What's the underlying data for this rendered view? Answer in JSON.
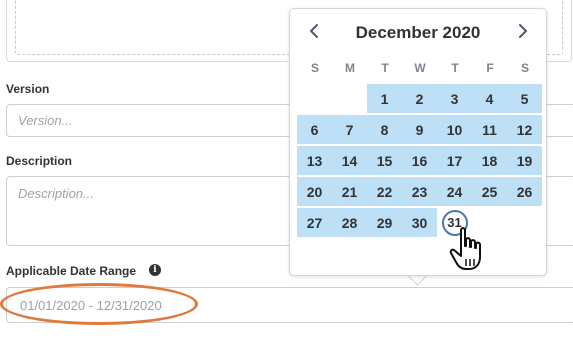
{
  "version": {
    "label": "Version",
    "placeholder": "Version..."
  },
  "description": {
    "label": "Description",
    "placeholder": "Description..."
  },
  "date_range": {
    "label": "Applicable Date Range",
    "value": "01/01/2020 - 12/31/2020",
    "info_icon": "info-icon",
    "info_glyph": "i"
  },
  "calendar": {
    "month_title": "December 2020",
    "prev_icon": "chevron-left-icon",
    "next_icon": "chevron-right-icon",
    "weekdays": [
      "S",
      "M",
      "T",
      "W",
      "T",
      "F",
      "S"
    ],
    "weeks": [
      [
        "",
        "",
        "1",
        "2",
        "3",
        "4",
        "5"
      ],
      [
        "6",
        "7",
        "8",
        "9",
        "10",
        "11",
        "12"
      ],
      [
        "13",
        "14",
        "15",
        "16",
        "17",
        "18",
        "19"
      ],
      [
        "20",
        "21",
        "22",
        "23",
        "24",
        "25",
        "26"
      ],
      [
        "27",
        "28",
        "29",
        "30",
        "31",
        "",
        ""
      ]
    ],
    "circled_day": "31",
    "range_highlight_color": "#bde0f7",
    "circle_color": "#4a78b5"
  },
  "annotation": {
    "ring_color": "#e07a3c"
  },
  "cursor": "hand-pointer-icon"
}
